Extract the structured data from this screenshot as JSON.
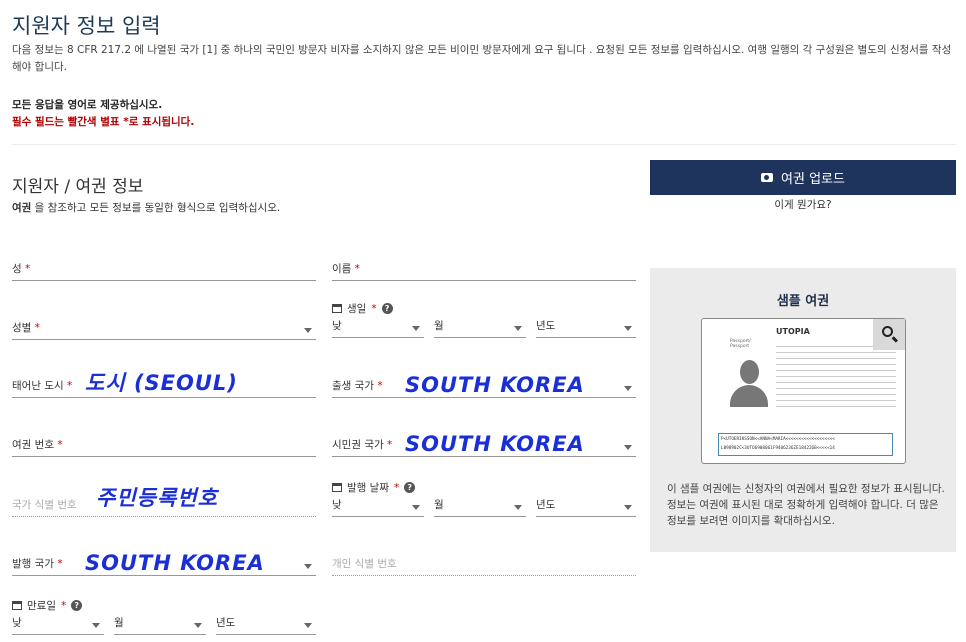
{
  "title": "지원자 정보 입력",
  "intro": "다음 정보는 8 CFR 217.2 에 나열된 국가 [1] 중 하나의 국민인 방문자 비자를 소지하지 않은 모든 비이민 방문자에게 요구 됩니다 . 요청된 모든 정보를 입력하십시오. 여행 일행의 각 구성원은 별도의 신청서를 작성해야 합니다.",
  "english_note": "모든 응답을 영어로 제공하십시오.",
  "required_note": "필수 필드는 빨간색 별표 *로 표시됩니다.",
  "section": {
    "title": "지원자 / 여권 정보",
    "sub_bold": "여권",
    "sub_rest": " 을 참조하고 모든 정보를 동일한 형식으로 입력하십시오."
  },
  "upload": {
    "label": "여권 업로드",
    "what": "이게 뭔가요?",
    "icon": "camera-icon"
  },
  "fields": {
    "surname": "성",
    "given": "이름",
    "sex": "성별",
    "birth_date": "생일",
    "birth_city": "태어난 도시",
    "birth_country": "출생 국가",
    "passport_no": "여권 번호",
    "citizenship": "시민권 국가",
    "national_id": "국가 식별 번호",
    "issue_date": "발행 날짜",
    "issue_country": "발행 국가",
    "personal_id": "개인 식별 번호",
    "expiry_date": "만료일"
  },
  "date_selects": {
    "day": "낮",
    "month": "월",
    "year": "년도"
  },
  "required_mark": "*",
  "handwriting": {
    "birth_city": "도시 (SEOUL)",
    "birth_country": "SOUTH KOREA",
    "citizenship": "SOUTH KOREA",
    "national_id": "주민등록번호",
    "issue_country": "SOUTH KOREA"
  },
  "sample": {
    "title": "샘플 여권",
    "desc": "이 샘플 여권에는 신청자의 여권에서 필요한 정보가 표시됩니다. 정보는 여권에 표시된 대로 정확하게 입력해야 합니다. 더 많은 정보를 보려면 이미지를 확대하십시오.",
    "country": "UTOPIA",
    "passport_word": "Passport/ Passport",
    "mrz1": "P<UTOERIKSSON<<ANNA<MARIA<<<<<<<<<<<<<<<<<<<",
    "mrz2": "L898902C<3UTO6908061F9406236ZE184226B<<<<<14"
  },
  "colors": {
    "accent": "#1e345c",
    "required": "#c00000",
    "handwriting": "#1a2fd6"
  }
}
